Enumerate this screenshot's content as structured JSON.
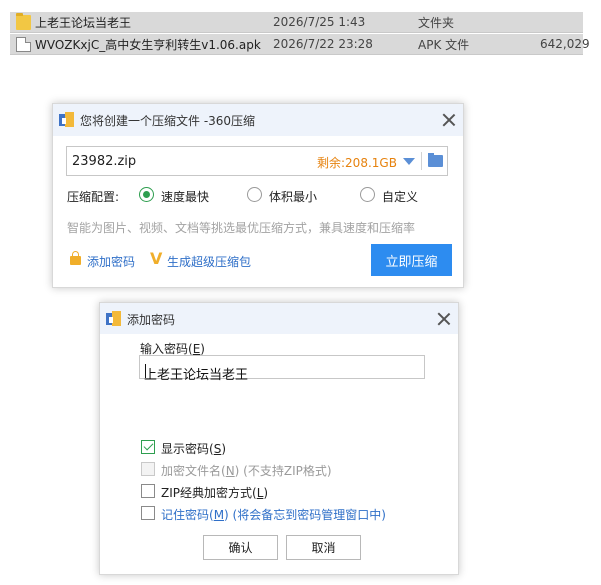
{
  "files": [
    {
      "name": "上老王论坛当老王",
      "date": "2026/7/25 1:43",
      "type": "文件夹",
      "size": "",
      "icon": "folder-icon"
    },
    {
      "name": "WVOZKxjC_高中女生亨利转生v1.06.apk",
      "date": "2026/7/22 23:28",
      "type": "APK 文件",
      "size": "642,029",
      "icon": "file-icon"
    }
  ],
  "compress_dialog": {
    "title": "您将创建一个压缩文件 -360压缩",
    "filename": "23982.zip",
    "remaining": "剩余:208.1GB",
    "config_label": "压缩配置:",
    "options": [
      {
        "label": "速度最快",
        "selected": true
      },
      {
        "label": "体积最小",
        "selected": false
      },
      {
        "label": "自定义",
        "selected": false
      }
    ],
    "hint": "智能为图片、视频、文档等挑选最优压缩方式，兼具速度和压缩率",
    "add_password": "添加密码",
    "super_package": "生成超级压缩包",
    "compress_button": "立即压缩",
    "accent_color": "#2d8cf0"
  },
  "password_dialog": {
    "title": "添加密码",
    "input_label_main": "输入密码(",
    "input_label_key": "E",
    "input_label_end": ")",
    "password_value": "上老王论坛当老王",
    "show_password": {
      "main": "显示密码(",
      "key": "S",
      "end": ")"
    },
    "encrypt_filename": {
      "main": "加密文件名(",
      "key": "N",
      "end": ") (不支持ZIP格式)"
    },
    "zip_classic": {
      "main": "ZIP经典加密方式(",
      "key": "L",
      "end": ")"
    },
    "remember": {
      "main": "记住密码(",
      "key": "M",
      "end": ") (将会备忘到密码管理窗口中)"
    },
    "ok_button": "确认",
    "cancel_button": "取消"
  }
}
